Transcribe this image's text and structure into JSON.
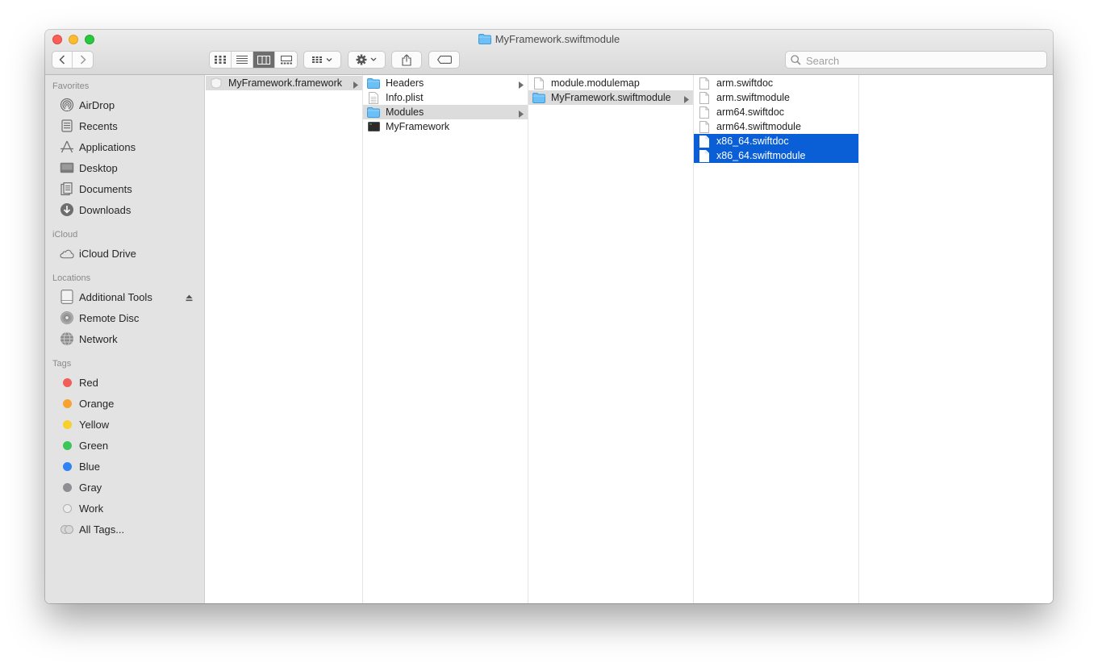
{
  "window": {
    "title": "MyFramework.swiftmodule"
  },
  "toolbar": {
    "back_icon": "chevron-left-icon",
    "forward_icon": "chevron-right-icon",
    "view_modes": [
      "icon-view-icon",
      "list-view-icon",
      "column-view-icon",
      "gallery-view-icon"
    ],
    "active_view": "column-view-icon",
    "search": {
      "placeholder": "Search",
      "value": ""
    }
  },
  "sidebar": {
    "favorites": {
      "header": "Favorites",
      "items": [
        {
          "label": "AirDrop",
          "icon": "airdrop-icon"
        },
        {
          "label": "Recents",
          "icon": "recents-icon"
        },
        {
          "label": "Applications",
          "icon": "applications-icon"
        },
        {
          "label": "Desktop",
          "icon": "desktop-icon"
        },
        {
          "label": "Documents",
          "icon": "documents-icon"
        },
        {
          "label": "Downloads",
          "icon": "downloads-icon"
        }
      ]
    },
    "icloud": {
      "header": "iCloud",
      "items": [
        {
          "label": "iCloud Drive",
          "icon": "cloud-icon"
        }
      ]
    },
    "locations": {
      "header": "Locations",
      "items": [
        {
          "label": "Additional Tools",
          "icon": "disk-icon"
        },
        {
          "label": "Remote Disc",
          "icon": "remote-disc-icon"
        },
        {
          "label": "Network",
          "icon": "network-icon"
        }
      ]
    },
    "tags": {
      "header": "Tags",
      "items": [
        {
          "label": "Red",
          "color": "#f25d57"
        },
        {
          "label": "Orange",
          "color": "#f8a230"
        },
        {
          "label": "Yellow",
          "color": "#f7d02e"
        },
        {
          "label": "Green",
          "color": "#3dc55a"
        },
        {
          "label": "Blue",
          "color": "#2f83f2"
        },
        {
          "label": "Gray",
          "color": "#8e8e93"
        },
        {
          "label": "Work",
          "color": "#e9e9e9"
        },
        {
          "label": "All Tags...",
          "color": "#cfcfcf"
        }
      ]
    }
  },
  "columns": [
    [
      {
        "name": "MyFramework.framework",
        "icon": "framework-icon",
        "has_children": true,
        "selected": "gray"
      }
    ],
    [
      {
        "name": "Headers",
        "icon": "folder-icon",
        "has_children": true
      },
      {
        "name": "Info.plist",
        "icon": "plist-file-icon"
      },
      {
        "name": "Modules",
        "icon": "folder-icon",
        "has_children": true,
        "selected": "gray"
      },
      {
        "name": "MyFramework",
        "icon": "executable-icon"
      }
    ],
    [
      {
        "name": "module.modulemap",
        "icon": "document-icon"
      },
      {
        "name": "MyFramework.swiftmodule",
        "icon": "folder-icon",
        "has_children": true,
        "selected": "gray"
      }
    ],
    [
      {
        "name": "arm.swiftdoc",
        "icon": "document-icon"
      },
      {
        "name": "arm.swiftmodule",
        "icon": "document-icon"
      },
      {
        "name": "arm64.swiftdoc",
        "icon": "document-icon"
      },
      {
        "name": "arm64.swiftmodule",
        "icon": "document-icon"
      },
      {
        "name": "x86_64.swiftdoc",
        "icon": "document-icon",
        "selected": "blue"
      },
      {
        "name": "x86_64.swiftmodule",
        "icon": "document-icon",
        "selected": "blue"
      }
    ]
  ],
  "colors": {
    "selection_blue": "#0a5fd6",
    "selection_gray": "#dcdcdc",
    "folder_blue": "#5eb8f2"
  }
}
